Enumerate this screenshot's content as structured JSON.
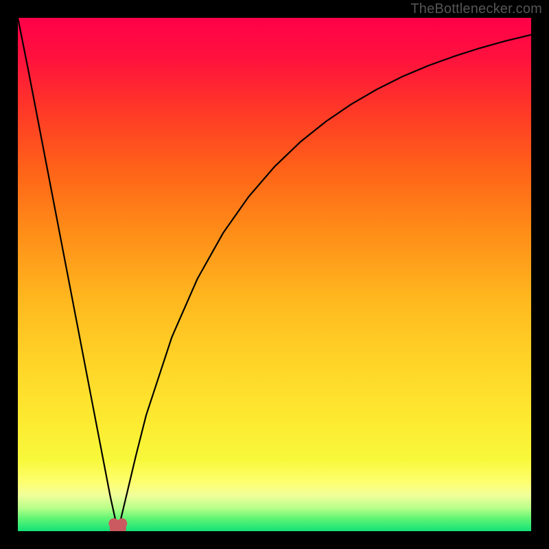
{
  "watermark": "TheBottlenecker.com",
  "chart_data": {
    "type": "line",
    "title": "",
    "xlabel": "",
    "ylabel": "",
    "xlim": [
      0,
      100
    ],
    "ylim": [
      0,
      100
    ],
    "series": [
      {
        "name": "bottleneck-curve",
        "x": [
          0,
          2,
          4,
          6,
          8,
          10,
          12,
          14,
          16,
          18,
          19.5,
          21,
          23,
          25,
          30,
          35,
          40,
          45,
          50,
          55,
          60,
          65,
          70,
          75,
          80,
          85,
          90,
          95,
          100
        ],
        "values": [
          100,
          90,
          79.6,
          69.2,
          58.8,
          48.4,
          38,
          27.6,
          17.2,
          6.8,
          0,
          6.3,
          14.7,
          22.6,
          37.8,
          49.2,
          58.1,
          65.2,
          71,
          75.8,
          79.8,
          83.2,
          86.1,
          88.6,
          90.7,
          92.5,
          94.1,
          95.5,
          96.7
        ]
      },
      {
        "name": "marker-cluster",
        "points": [
          {
            "x": 18.7,
            "y": 1.5
          },
          {
            "x": 18.9,
            "y": 0.5
          },
          {
            "x": 19.5,
            "y": 0.2
          },
          {
            "x": 20.1,
            "y": 0.5
          },
          {
            "x": 20.3,
            "y": 1.5
          }
        ]
      }
    ],
    "gradient_stops": [
      {
        "offset": 0,
        "color": "#ff0049"
      },
      {
        "offset": 0.08,
        "color": "#ff123d"
      },
      {
        "offset": 0.18,
        "color": "#ff3827"
      },
      {
        "offset": 0.3,
        "color": "#ff6418"
      },
      {
        "offset": 0.42,
        "color": "#ff8e18"
      },
      {
        "offset": 0.55,
        "color": "#ffb81f"
      },
      {
        "offset": 0.68,
        "color": "#ffd628"
      },
      {
        "offset": 0.78,
        "color": "#fde930"
      },
      {
        "offset": 0.86,
        "color": "#f8f83a"
      },
      {
        "offset": 0.905,
        "color": "#feff70"
      },
      {
        "offset": 0.93,
        "color": "#f1ff9a"
      },
      {
        "offset": 0.955,
        "color": "#b7ff8a"
      },
      {
        "offset": 0.975,
        "color": "#62f574"
      },
      {
        "offset": 1.0,
        "color": "#12e277"
      }
    ],
    "marker_color": "#cb5960",
    "curve_color": "#000000"
  }
}
